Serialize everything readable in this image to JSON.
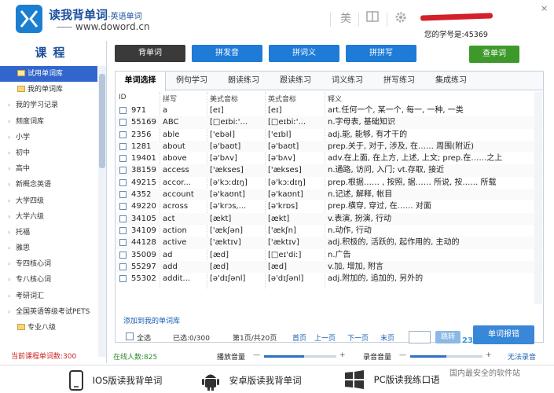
{
  "header": {
    "brand_name": "读我背单词",
    "brand_sub": "-英语单词",
    "brand_url": "www.doword.cn",
    "icon_beauty": "美",
    "user_id_text": "您的学号是:45369",
    "close_glyph": "×"
  },
  "sidebar": {
    "title": "课程",
    "items": [
      {
        "label": "试用单词库",
        "type": "sub",
        "selected": true
      },
      {
        "label": "我的单词库",
        "type": "sub"
      },
      {
        "label": "我的学习记录",
        "type": "group"
      },
      {
        "label": "频度词库",
        "type": "group"
      },
      {
        "label": "小学",
        "type": "group"
      },
      {
        "label": "初中",
        "type": "group"
      },
      {
        "label": "高中",
        "type": "group"
      },
      {
        "label": "新概念英语",
        "type": "group"
      },
      {
        "label": "大学四级",
        "type": "group"
      },
      {
        "label": "大学六级",
        "type": "group"
      },
      {
        "label": "托福",
        "type": "group"
      },
      {
        "label": "雅思",
        "type": "group"
      },
      {
        "label": "专四核心词",
        "type": "group"
      },
      {
        "label": "专八核心词",
        "type": "group"
      },
      {
        "label": "考研词汇",
        "type": "group"
      },
      {
        "label": "全国英语等级考试PETS",
        "type": "group"
      },
      {
        "label": "专业八级",
        "type": "sub"
      }
    ],
    "count_text": "当前课程单词数:300"
  },
  "actions": {
    "memorize": "背单词",
    "spell_sound": "拼发音",
    "spell_meaning": "拼词义",
    "spell_write": "拼拼写",
    "lookup": "查单词"
  },
  "tabs": [
    "单词选择",
    "例句学习",
    "朗读练习",
    "跟读练习",
    "词义练习",
    "拼写练习",
    "集成练习"
  ],
  "columns": {
    "id": "ID",
    "word": "拼写",
    "us": "美式音标",
    "uk": "英式音标",
    "def": "释义"
  },
  "rows": [
    {
      "id": "971",
      "word": "a",
      "us": "[eɪ]",
      "uk": "[eɪ]",
      "def": "art.任何一个, 某一个, 每一, 一种, 一类"
    },
    {
      "id": "55169",
      "word": "ABC",
      "us": "[□eɪbiː'...",
      "uk": "[□eɪbiː'...",
      "def": "n.字母表, 基础知识"
    },
    {
      "id": "2356",
      "word": "able",
      "us": "['ebəl]",
      "uk": "['eɪbl]",
      "def": "adj.能, 能够, 有才干的"
    },
    {
      "id": "1281",
      "word": "about",
      "us": "[ə'baʊt]",
      "uk": "[ə'baʊt]",
      "def": "prep.关于, 对于, 涉及, 在…… 周围(附近)"
    },
    {
      "id": "19401",
      "word": "above",
      "us": "[ə'bʌv]",
      "uk": "[ə'bʌv]",
      "def": "adv.在上面, 在上方, 上述, 上文; prep.在……之上"
    },
    {
      "id": "38159",
      "word": "access",
      "us": "['ækses]",
      "uk": "['ækses]",
      "def": "n.通路, 访问, 入门; vt.存取, 接近"
    },
    {
      "id": "49215",
      "word": "accor...",
      "us": "[ə'kɔːdɪŋ]",
      "uk": "[ə'kɔːdɪŋ]",
      "def": "prep.根据…… , 按照, 据…… 所说, 按…… 所载"
    },
    {
      "id": "4352",
      "word": "account",
      "us": "[ə'kaʊnt]",
      "uk": "[ə'kaʊnt]",
      "def": "n.记述, 解释, 帐目"
    },
    {
      "id": "49220",
      "word": "across",
      "us": "[ə'krɔs,...",
      "uk": "[ə'krɒs]",
      "def": "prep.横穿, 穿过, 在…… 对面"
    },
    {
      "id": "34105",
      "word": "act",
      "us": "[ækt]",
      "uk": "[ækt]",
      "def": "v.表演, 扮演, 行动"
    },
    {
      "id": "34109",
      "word": "action",
      "us": "['ækʃən]",
      "uk": "['ækʃn]",
      "def": "n.动作, 行动"
    },
    {
      "id": "44128",
      "word": "active",
      "us": "['æktɪv]",
      "uk": "['æktɪv]",
      "def": "adj.积极的, 活跃的, 起作用的, 主动的"
    },
    {
      "id": "35009",
      "word": "ad",
      "us": "[æd]",
      "uk": "[□eɪ'diː]",
      "def": "n.广告"
    },
    {
      "id": "55297",
      "word": "add",
      "us": "[æd]",
      "uk": "[æd]",
      "def": "v.加, 增加, 附言"
    },
    {
      "id": "55302",
      "word": "addit...",
      "us": "[ə'dɪʃənl]",
      "uk": "[ə'dɪʃənl]",
      "def": "adj.附加的, 追加的, 另外的"
    }
  ],
  "add_link": "添加到我的单词库",
  "pager": {
    "select_all": "全选",
    "selected": "已选:0/300",
    "page_info": "第1页/共20页",
    "first": "首页",
    "prev": "上一页",
    "next": "下一页",
    "last": "末页",
    "goto": "跳转",
    "report": "单词报错"
  },
  "status": {
    "online": "在线人数:825",
    "play_volume": "播放音量",
    "play_level": 0.55,
    "record_volume": "录音音量",
    "record_level": 0.5,
    "no_record": "无法录音",
    "minus": "—",
    "plus": "+"
  },
  "apps": {
    "ios": "IOS版读我背单词",
    "android": "安卓版读我背单词",
    "pc": "PC版读我练口语"
  },
  "watermark": {
    "site": "2345软件大全",
    "slogan": "国内最安全的软件站"
  },
  "colors": {
    "brand_blue": "#1a7fd1",
    "button_blue": "#1e7bd6",
    "button_green": "#3d9a2a",
    "selected_blue": "#3366cc",
    "count_red": "#cc2222"
  }
}
